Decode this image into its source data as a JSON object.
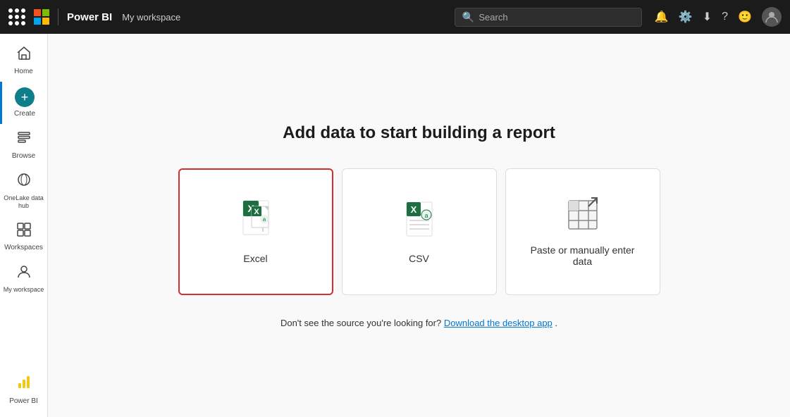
{
  "topnav": {
    "brand": "Power BI",
    "workspace": "My workspace",
    "search_placeholder": "Search",
    "icons": [
      "bell",
      "settings",
      "download",
      "help",
      "smiley"
    ]
  },
  "sidebar": {
    "items": [
      {
        "label": "Home",
        "icon": "home"
      },
      {
        "label": "Create",
        "icon": "create",
        "active": true
      },
      {
        "label": "Browse",
        "icon": "browse"
      },
      {
        "label": "OneLake data hub",
        "icon": "onelake"
      },
      {
        "label": "Workspaces",
        "icon": "workspaces"
      },
      {
        "label": "My workspace",
        "icon": "myworkspace"
      }
    ],
    "bottom_label": "Power BI"
  },
  "content": {
    "title": "Add data to start building a report",
    "cards": [
      {
        "id": "excel",
        "label": "Excel",
        "selected": true
      },
      {
        "id": "csv",
        "label": "CSV",
        "selected": false
      },
      {
        "id": "paste",
        "label": "Paste or manually enter\ndata",
        "selected": false
      }
    ],
    "footer": "Don't see the source you're looking for?",
    "footer_link": "Download the desktop app",
    "footer_end": "."
  }
}
